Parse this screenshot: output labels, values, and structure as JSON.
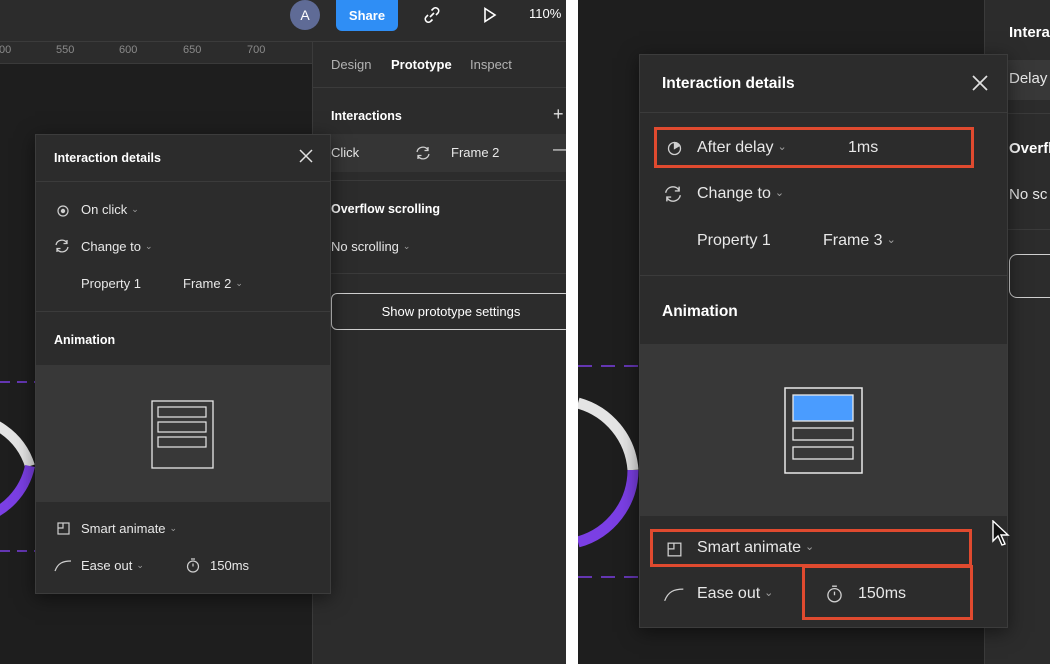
{
  "toolbar": {
    "avatar_letter": "A",
    "share_label": "Share",
    "zoom": "110%"
  },
  "ruler": {
    "ticks": [
      "00",
      "550",
      "600",
      "650",
      "700"
    ]
  },
  "panel": {
    "tabs": [
      "Design",
      "Prototype",
      "Inspect"
    ],
    "interactions_title": "Interactions",
    "interaction_trigger": "Click",
    "interaction_target": "Frame 2",
    "overflow_title": "Overflow scrolling",
    "overflow_value": "No scrolling",
    "show_settings_label": "Show prototype settings"
  },
  "left_dialog": {
    "title": "Interaction details",
    "trigger": "On click",
    "action": "Change to",
    "property_label": "Property 1",
    "property_value": "Frame 2",
    "animation_title": "Animation",
    "animation_type": "Smart animate",
    "easing": "Ease out",
    "duration": "150ms"
  },
  "right_dialog": {
    "title": "Interaction details",
    "trigger": "After delay",
    "delay": "1ms",
    "action": "Change to",
    "property_label": "Property 1",
    "property_value": "Frame 3",
    "animation_title": "Animation",
    "animation_type": "Smart animate",
    "easing": "Ease out",
    "duration": "150ms"
  },
  "right_partial_panel": {
    "interactions_title_fragment": "Intera",
    "trigger_fragment": "Delay",
    "overflow_fragment": "Overfl",
    "scroll_fragment": "No sc"
  },
  "colors": {
    "accent": "#2f8ef5",
    "highlight": "#e04a2f",
    "ring_purple": "#7b3fe4",
    "preview_blue": "#4a9cff"
  }
}
